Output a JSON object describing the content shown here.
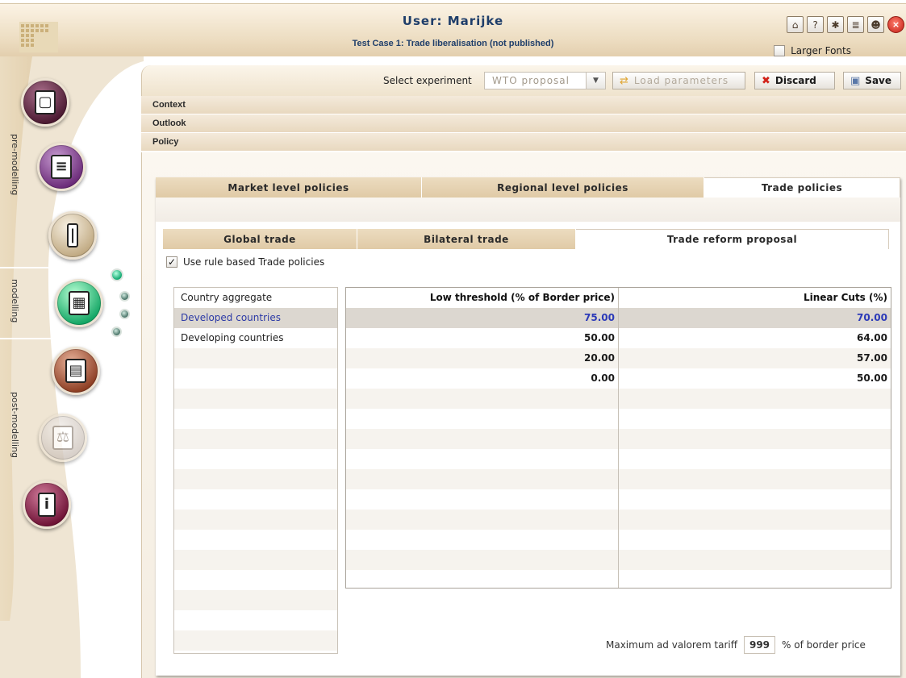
{
  "header": {
    "user": "User: Marijke",
    "case": "Test Case 1: Trade liberalisation (not published)",
    "larger_fonts": "Larger Fonts",
    "icons": [
      "home-icon",
      "help-icon",
      "bug-icon",
      "books-icon",
      "users-icon",
      "close-icon"
    ]
  },
  "sidebar": {
    "sections": [
      "pre-modelling",
      "modelling",
      "post-modelling"
    ],
    "buttons": [
      "clipboard-icon",
      "books-icon",
      "thermometer-icon",
      "calculator-icon",
      "chart-icon",
      "scales-icon",
      "info-icon"
    ]
  },
  "toolbar": {
    "select_label": "Select experiment",
    "experiment": "WTO proposal",
    "load_label": "Load parameters",
    "discard_label": "Discard",
    "save_label": "Save"
  },
  "accordion": [
    "Context",
    "Outlook",
    "Policy"
  ],
  "policy_tabs": [
    "Market level policies",
    "Regional level policies",
    "Trade policies"
  ],
  "trade_tabs": [
    "Global trade",
    "Bilateral trade",
    "Trade reform proposal"
  ],
  "use_rule_label": "Use rule based Trade policies",
  "country_list": {
    "header": "Country aggregate",
    "items": [
      "Developed countries",
      "Developing countries"
    ]
  },
  "grid": {
    "headers": [
      "Low threshold (% of Border price)",
      "Linear Cuts (%)"
    ],
    "rows": [
      [
        "75.00",
        "70.00"
      ],
      [
        "50.00",
        "64.00"
      ],
      [
        "20.00",
        "57.00"
      ],
      [
        "0.00",
        "50.00"
      ]
    ]
  },
  "footer": {
    "label": "Maximum ad valorem tariff",
    "value": "999",
    "unit": "% of border price"
  }
}
